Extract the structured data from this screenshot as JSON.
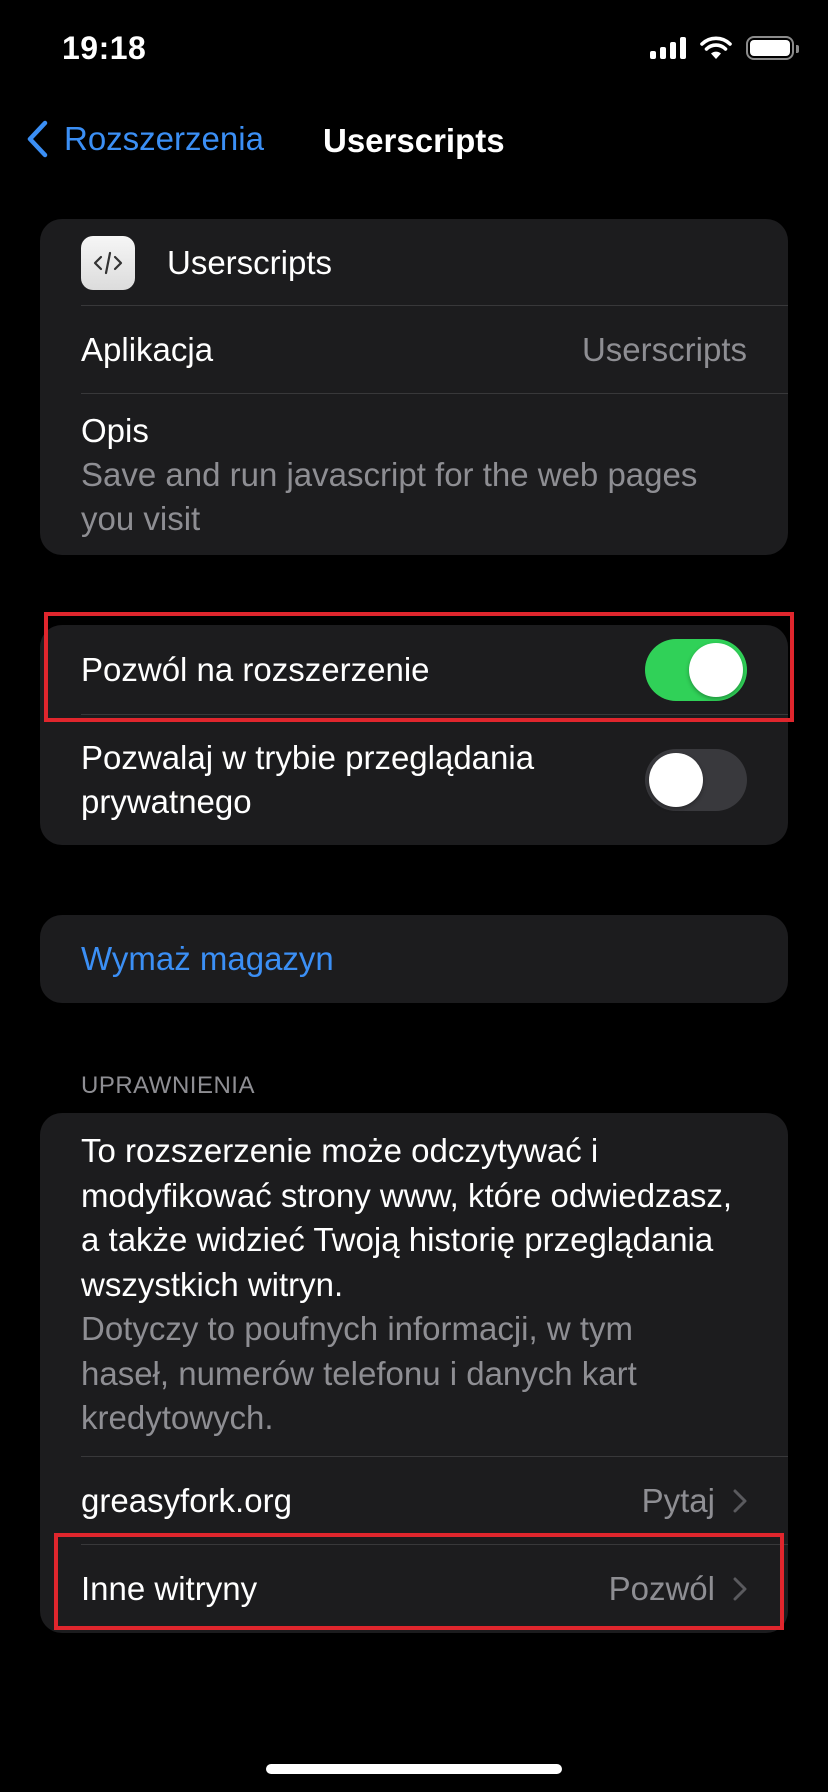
{
  "status_bar": {
    "time": "19:18",
    "icons": [
      "signal-icon",
      "wifi-icon",
      "battery-icon"
    ]
  },
  "nav": {
    "back_label": "Rozszerzenia",
    "title": "Userscripts"
  },
  "info": {
    "extension_name": "Userscripts",
    "app_label": "Aplikacja",
    "app_value": "Userscripts",
    "description_label": "Opis",
    "description_text": "Save and run javascript for the web pages you visit"
  },
  "toggles": {
    "allow_extension_label": "Pozwól na rozszerzenie",
    "allow_extension_on": true,
    "private_label": "Pozwalaj w trybie przeglądania prywatnego",
    "private_on": false
  },
  "storage": {
    "clear_label": "Wymaż magazyn"
  },
  "permissions": {
    "header": "UPRAWNIENIA",
    "main_text": "To rozszerzenie może odczytywać i modyfikować strony www, które odwiedzasz, a także widzieć Twoją historię przeglądania wszystkich witryn.",
    "secondary_text": "Dotyczy to poufnych informacji, w tym haseł, numerów telefonu i danych kart kredytowych.",
    "sites": [
      {
        "name": "greasyfork.org",
        "value": "Pytaj"
      },
      {
        "name": "Inne witryny",
        "value": "Pozwól"
      }
    ]
  },
  "colors": {
    "accent": "#3b8ff5",
    "toggle_on": "#30d158",
    "highlight": "#e0262d",
    "card": "#1c1c1e"
  }
}
